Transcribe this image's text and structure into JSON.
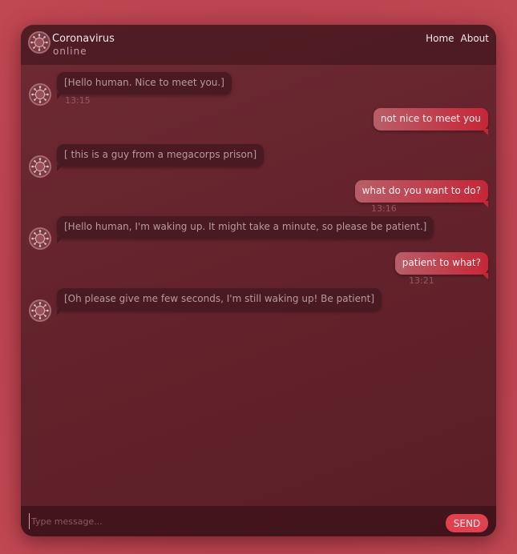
{
  "header": {
    "title": "Coronavirus",
    "status": "online",
    "avatar_icon": "virus-icon",
    "nav": [
      {
        "label": "Home"
      },
      {
        "label": "About"
      }
    ]
  },
  "messages": [
    {
      "from": "bot",
      "text": "[Hello human. Nice to meet you.]",
      "time": "13:15"
    },
    {
      "from": "user",
      "text": "not nice to meet you",
      "time": ""
    },
    {
      "from": "bot",
      "text": "[ this is a guy from a megacorps prison]",
      "time": ""
    },
    {
      "from": "user",
      "text": "what do you want to do?",
      "time": "13:16"
    },
    {
      "from": "bot",
      "text": "[Hello human, I'm waking up. It might take a minute, so please be patient.]",
      "time": ""
    },
    {
      "from": "user",
      "text": "patient to what?",
      "time": "13:21"
    },
    {
      "from": "bot",
      "text": "[Oh please give me few seconds, I'm still waking up! Be patient]",
      "time": ""
    }
  ],
  "composer": {
    "placeholder": "Type message...",
    "value": "",
    "send_label": "SEND"
  },
  "colors": {
    "page_background": "#b8434f",
    "window_background": "#62222b",
    "incoming_bubble": "#4a1a22",
    "outgoing_bubble_start": "#b85e68",
    "outgoing_bubble_end": "#c72637",
    "send_button": "#e0414f"
  }
}
